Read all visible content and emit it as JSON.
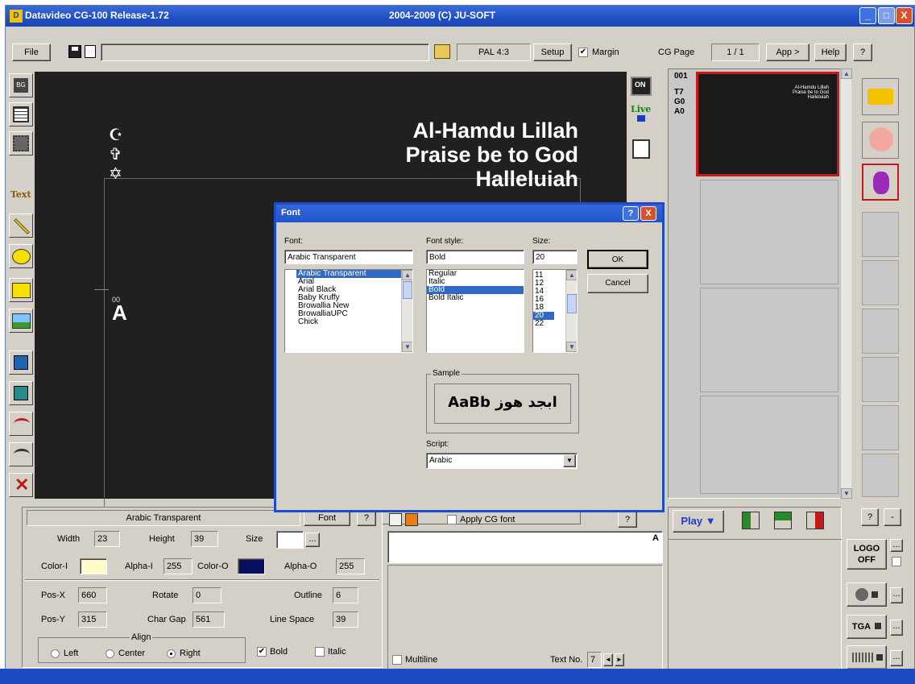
{
  "titlebar": {
    "app_title": "Datavideo CG-100  Release-1.72",
    "copyright": "2004-2009 (C) JU-SOFT",
    "min_label": "_",
    "max_label": "□",
    "close_label": "X"
  },
  "toolbar": {
    "file_label": "File",
    "format_value": "PAL 4:3",
    "setup_label": "Setup",
    "margin_label": "Margin",
    "margin_checked": "✔",
    "cg_page_label": "CG Page",
    "cg_page_value": "1 / 1",
    "app_label": "App >",
    "help_label": "Help",
    "question_label": "?"
  },
  "left_tools": {
    "text_tool_label": "Text"
  },
  "canvas": {
    "lines": [
      "Al-Hamdu Lillah",
      "Praise be to God",
      "Halleluiah"
    ],
    "symbols": [
      "☪",
      "✞",
      "✡"
    ],
    "object_tag": "00",
    "object_letter": "A",
    "on_label": "ON",
    "live_label": "Live"
  },
  "pages_panel": {
    "page_code_lines": [
      "001",
      "T7",
      "G0",
      "A0"
    ],
    "thumb_preview_lines": [
      "Al-Hamdu Lillah",
      "Praise be to God",
      "Halleluiah"
    ]
  },
  "font_dialog": {
    "title": "Font",
    "help_label": "?",
    "close_label": "X",
    "font_label": "Font:",
    "font_value": "Arabic Transparent",
    "style_label": "Font style:",
    "style_value": "Bold",
    "size_label": "Size:",
    "size_value": "20",
    "ok_label": "OK",
    "cancel_label": "Cancel",
    "fonts": [
      "Arabic Transparent",
      "Arial",
      "Arial Black",
      "Baby Kruffy",
      "Browallia New",
      "BrowalliaUPC",
      "Chick"
    ],
    "styles": [
      "Regular",
      "Italic",
      "Bold",
      "Bold Italic"
    ],
    "sizes": [
      "11",
      "12",
      "14",
      "16",
      "18",
      "20",
      "22"
    ],
    "sample_label": "Sample",
    "sample_text": "AaBb ابجد هوز",
    "script_label": "Script:",
    "script_value": "Arabic"
  },
  "props": {
    "font_name": "Arabic Transparent",
    "font_button": "Font",
    "help_button": "?",
    "width_label": "Width",
    "width_value": "23",
    "height_label": "Height",
    "height_value": "39",
    "size_label": "Size",
    "size_btn": "...",
    "color_i_label": "Color-I",
    "alpha_i_label": "Alpha-I",
    "alpha_i_value": "255",
    "color_o_label": "Color-O",
    "alpha_o_label": "Alpha-O",
    "alpha_o_value": "255",
    "pos_x_label": "Pos-X",
    "pos_x_value": "660",
    "pos_y_label": "Pos-Y",
    "pos_y_value": "315",
    "rotate_label": "Rotate",
    "rotate_value": "0",
    "char_gap_label": "Char Gap",
    "char_gap_value": "561",
    "outline_label": "Outline",
    "outline_value": "6",
    "line_space_label": "Line Space",
    "line_space_value": "39",
    "align_label": "Align",
    "align_left": "Left",
    "align_center": "Center",
    "align_right": "Right",
    "bold_label": "Bold",
    "italic_label": "Italic",
    "color_i_hex": "#fffbc8",
    "color_o_hex": "#0a1060"
  },
  "text_editor": {
    "apply_cg_font_label": "Apply CG font",
    "help_label": "?",
    "text_value": "A",
    "multiline_label": "Multiline",
    "text_no_label": "Text No.",
    "text_no_value": "7"
  },
  "play_panel": {
    "play_label": "Play ▼",
    "help_label": "?",
    "minus_label": "-",
    "logo_label": "LOGO\nOFF",
    "tga_label": "TGA",
    "dots_label": "..."
  }
}
